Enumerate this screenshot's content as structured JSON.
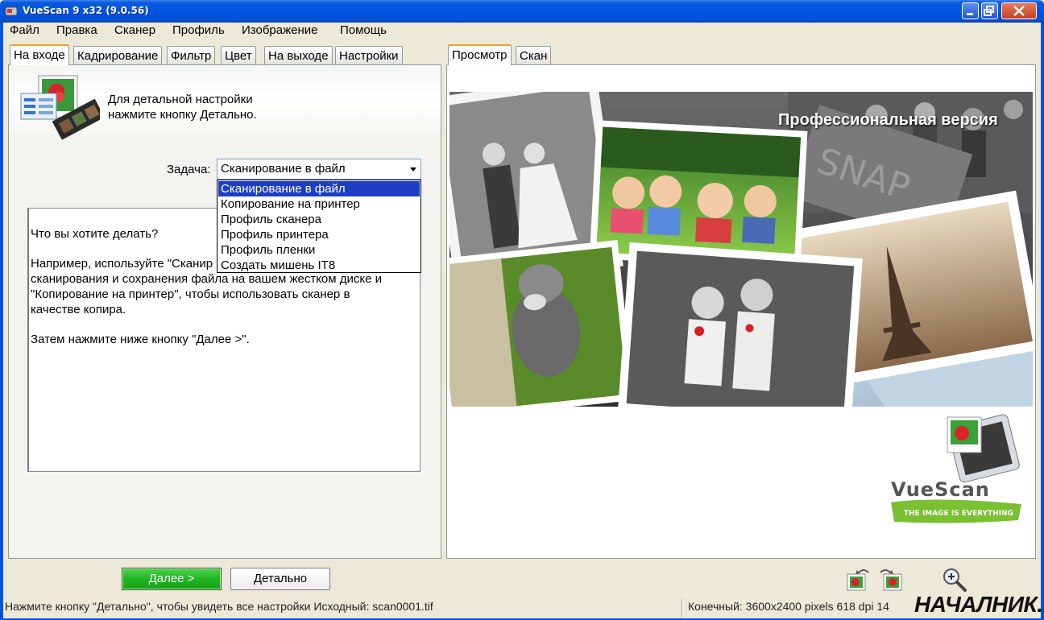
{
  "window": {
    "title": "VueScan 9 x32 (9.0.56)"
  },
  "menu": [
    "Файл",
    "Правка",
    "Сканер",
    "Профиль",
    "Изображение",
    "Помощь"
  ],
  "left_tabs": [
    "На входе",
    "Кадрирование",
    "Фильтр",
    "Цвет",
    "На выходе",
    "Настройки"
  ],
  "right_tabs": [
    "Просмотр",
    "Скан"
  ],
  "input_tab": {
    "info_line1": "Для детальной настройки",
    "info_line2": "нажмите кнопку Детально.",
    "task_label": "Задача:",
    "task_value": "Сканирование в файл",
    "task_options": [
      "Сканирование в файл",
      "Копирование на принтер",
      "Профиль сканера",
      "Профиль принтера",
      "Профиль пленки",
      "Создать мишень IT8"
    ],
    "help_p1": "Что вы хотите делать?",
    "help_p2": "Например, используйте \"Сканир",
    "help_p2b": "сканирования и сохранения файла на вашем жестком диске и\n\"Копирование на принтер\", чтобы использовать сканер в\nкачестве копира.",
    "help_p3": "Затем нажмите ниже кнопку \"Далее >\"."
  },
  "buttons": {
    "next": "Далее >",
    "detail": "Детально"
  },
  "preview": {
    "pro_text": "Профессиональная версия",
    "logo_text": "VueScan",
    "logo_tagline": "THE IMAGE IS EVERYTHING"
  },
  "status": {
    "left": "Нажмите кнопку \"Детально\", чтобы увидеть все настройки Исходный: scan0001.tif",
    "right": "Конечный: 3600x2400 pixels 618 dpi 14"
  },
  "watermark": "НАЧАЛНИК.РУ",
  "colors": {
    "titlebar": "#0054e3",
    "selection": "#1c3ec3",
    "next_button": "#1fb51f",
    "tab_highlight": "#f0a22e"
  }
}
